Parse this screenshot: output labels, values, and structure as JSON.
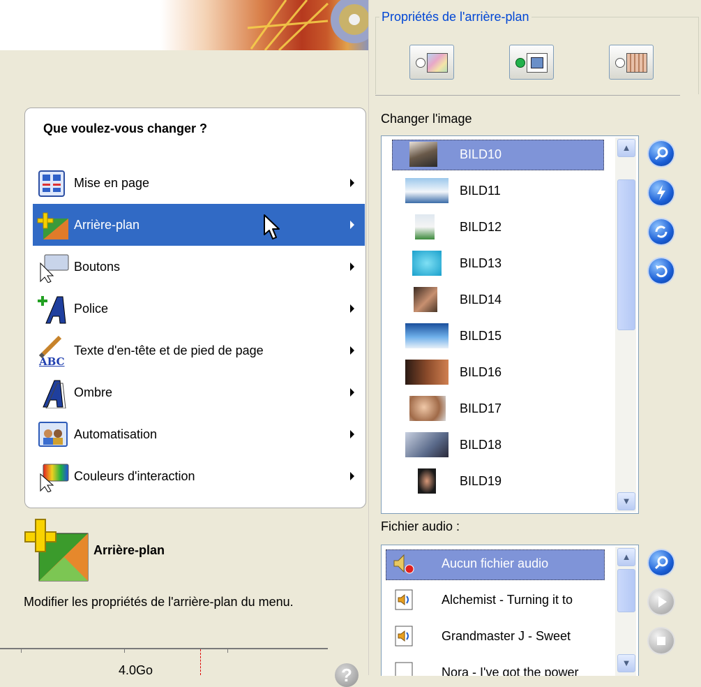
{
  "menu": {
    "title": "Que voulez-vous changer ?",
    "items": [
      {
        "label": "Mise en page"
      },
      {
        "label": "Arrière-plan",
        "selected": true
      },
      {
        "label": "Boutons"
      },
      {
        "label": "Police"
      },
      {
        "label": "Texte d'en-tête et de pied de page"
      },
      {
        "label": "Ombre"
      },
      {
        "label": "Automatisation"
      },
      {
        "label": "Couleurs d'interaction"
      }
    ]
  },
  "description": {
    "title": "Arrière-plan",
    "text": "Modifier les propriétés de l'arrière-plan du menu."
  },
  "status": {
    "capacity": "4.0Go",
    "help_glyph": "?"
  },
  "properties": {
    "title": "Propriétés de l'arrière-plan",
    "modes": [
      {
        "icon": "background-image-icon",
        "selected": false
      },
      {
        "icon": "background-frame-icon",
        "selected": true
      },
      {
        "icon": "background-video-icon",
        "selected": false
      }
    ]
  },
  "images": {
    "label": "Changer l'image",
    "items": [
      "BILD10",
      "BILD11",
      "BILD12",
      "BILD13",
      "BILD14",
      "BILD15",
      "BILD16",
      "BILD17",
      "BILD18",
      "BILD19"
    ],
    "selected": "BILD10"
  },
  "audio": {
    "label": "Fichier audio :",
    "items": [
      "Aucun fichier audio",
      "Alchemist - Turning it to",
      "Grandmaster J - Sweet",
      "Nora - I've got the power"
    ],
    "selected": "Aucun fichier audio"
  },
  "colors": {
    "selection": "#316ac5",
    "list_selection": "#7f94d8",
    "group_title": "#0046d5",
    "panel": "#ece9d8"
  }
}
